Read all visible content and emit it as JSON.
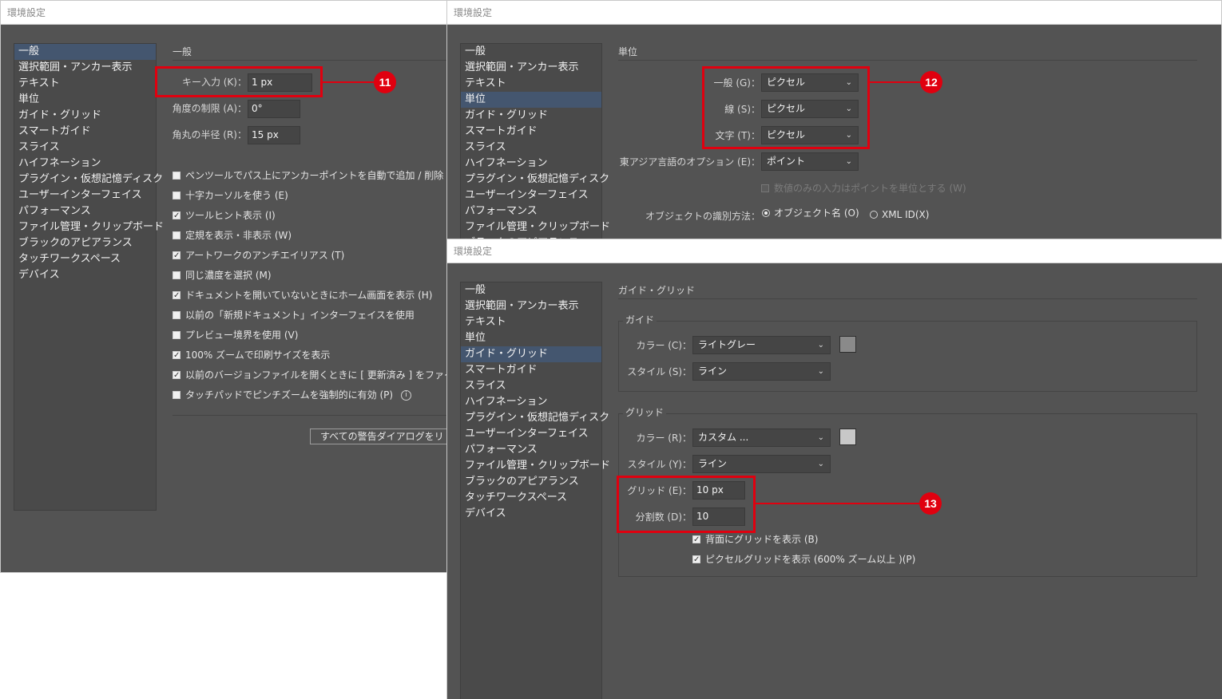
{
  "window_title": "環境設定",
  "nav_items": [
    "一般",
    "選択範囲・アンカー表示",
    "テキスト",
    "単位",
    "ガイド・グリッド",
    "スマートガイド",
    "スライス",
    "ハイフネーション",
    "プラグイン・仮想記憶ディスク",
    "ユーザーインターフェイス",
    "パフォーマンス",
    "ファイル管理・クリップボード",
    "ブラックのアピアランス",
    "タッチワークスペース",
    "デバイス"
  ],
  "general": {
    "section_title": "一般",
    "key_input_label": "キー入力 (K)：",
    "key_input_value": "1 px",
    "angle_label": "角度の制限 (A)：",
    "angle_value": "0°",
    "corner_label": "角丸の半径 (R)：",
    "corner_value": "15 px",
    "checkboxes": [
      {
        "label": "ペンツールでパス上にアンカーポイントを自動で追加 / 削除",
        "checked": false
      },
      {
        "label": "十字カーソルを使う (E)",
        "checked": false
      },
      {
        "label": "ツールヒント表示 (I)",
        "checked": true
      },
      {
        "label": "定規を表示・非表示 (W)",
        "checked": false
      },
      {
        "label": "アートワークのアンチエイリアス (T)",
        "checked": true
      },
      {
        "label": "同じ濃度を選択 (M)",
        "checked": false
      },
      {
        "label": "ドキュメントを開いていないときにホーム画面を表示 (H)",
        "checked": true
      },
      {
        "label": "以前の「新規ドキュメント」インターフェイスを使用",
        "checked": false
      },
      {
        "label": "プレビュー境界を使用 (V)",
        "checked": false
      },
      {
        "label": "100% ズームで印刷サイズを表示",
        "checked": true
      },
      {
        "label": "以前のバージョンファイルを開くときに [ 更新済み ] をファイ",
        "checked": true
      },
      {
        "label": "タッチパッドでピンチズームを強制的に有効 (P)",
        "checked": false
      }
    ],
    "info_icon": "info-icon",
    "reset_button": "すべての警告ダイアログをリ"
  },
  "units": {
    "section_title": "単位",
    "general_label": "一般 (G)：",
    "general_value": "ピクセル",
    "stroke_label": "線 (S)：",
    "stroke_value": "ピクセル",
    "type_label": "文字 (T)：",
    "type_value": "ピクセル",
    "east_asian_label": "東アジア言語のオプション (E)：",
    "east_asian_value": "ポイント",
    "numbers_only_label": "数値のみの入力はポイントを単位とする (W)",
    "object_id_label": "オブジェクトの識別方法：",
    "object_name_option": "オブジェクト名 (O)",
    "xml_id_option": "XML ID(X)"
  },
  "guides": {
    "section_title": "ガイド・グリッド",
    "guide_group": "ガイド",
    "guide_color_label": "カラー (C)：",
    "guide_color_value": "ライトグレー",
    "guide_color_swatch": "#8a8a8a",
    "guide_style_label": "スタイル (S)：",
    "guide_style_value": "ライン",
    "grid_group": "グリッド",
    "grid_color_label": "カラー (R)：",
    "grid_color_value": "カスタム ...",
    "grid_color_swatch": "#c8c8c8",
    "grid_style_label": "スタイル (Y)：",
    "grid_style_value": "ライン",
    "gridline_label": "グリッド (E)：",
    "gridline_value": "10 px",
    "subdivisions_label": "分割数 (D)：",
    "subdivisions_value": "10",
    "grids_in_back_label": "背面にグリッドを表示 (B)",
    "pixel_grid_label": "ピクセルグリッドを表示 (600% ズーム以上 )(P)"
  },
  "callouts": [
    "11",
    "12",
    "13"
  ],
  "colors": {
    "callout": "#e0000f",
    "panel": "#535353",
    "selected": "#44566f"
  }
}
